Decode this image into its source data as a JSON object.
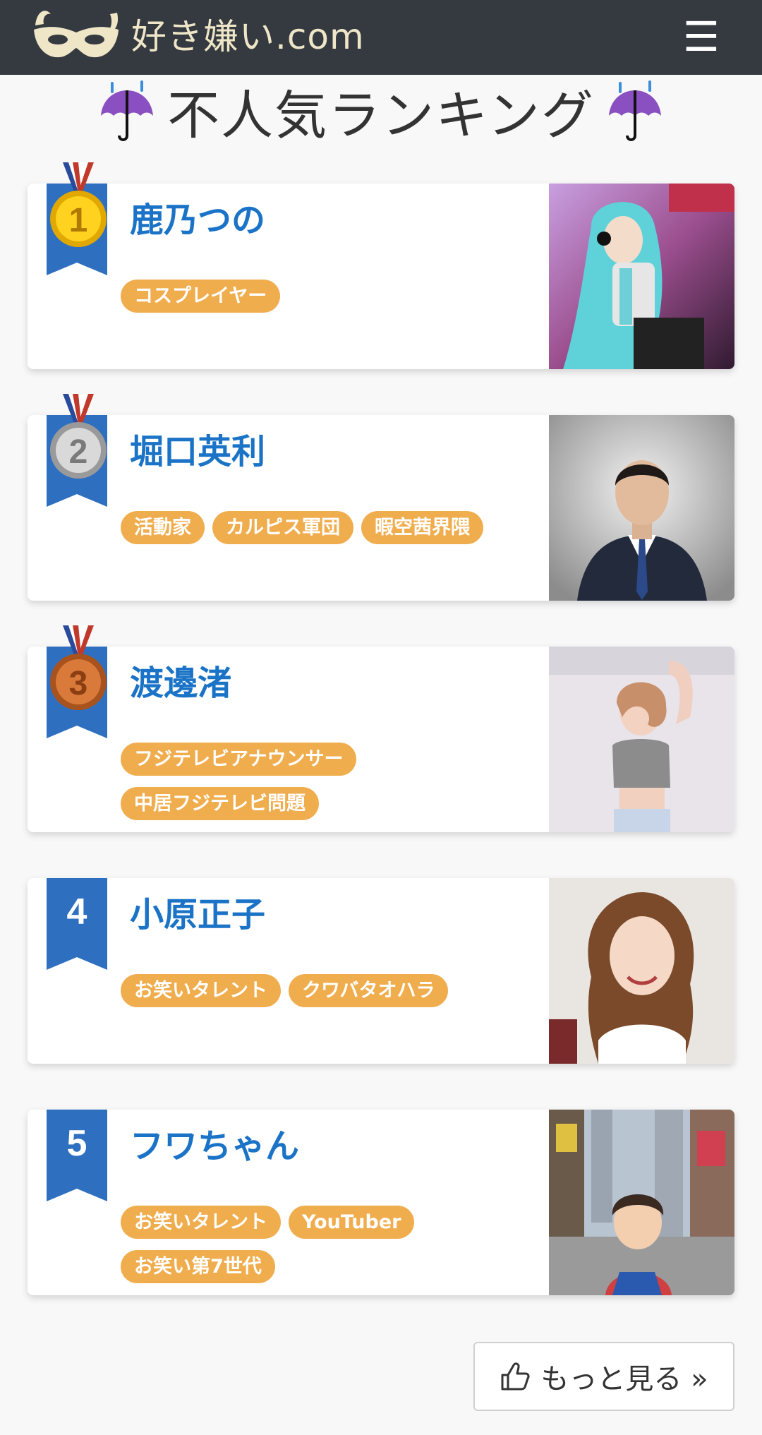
{
  "header": {
    "logo_text": "好き嫌い.com",
    "menu_icon": "hamburger-icon",
    "menu_glyph": "☰"
  },
  "title": {
    "text": "不人気ランキング",
    "left_icon": "umbrella-rain-icon",
    "right_icon": "umbrella-rain-icon"
  },
  "ranking": [
    {
      "rank": "1",
      "badge": "gold-medal-icon",
      "name": "鹿乃つの",
      "tags": [
        "コスプレイヤー"
      ],
      "photo": "person-photo"
    },
    {
      "rank": "2",
      "badge": "silver-medal-icon",
      "name": "堀口英利",
      "tags": [
        "活動家",
        "カルピス軍団",
        "暇空茜界隈"
      ],
      "photo": "person-photo"
    },
    {
      "rank": "3",
      "badge": "bronze-medal-icon",
      "name": "渡邊渚",
      "tags": [
        "フジテレビアナウンサー",
        "中居フジテレビ問題"
      ],
      "photo": "person-photo"
    },
    {
      "rank": "4",
      "badge": "ribbon",
      "name": "小原正子",
      "tags": [
        "お笑いタレント",
        "クワバタオハラ"
      ],
      "photo": "person-photo"
    },
    {
      "rank": "5",
      "badge": "ribbon",
      "name": "フワちゃん",
      "tags": [
        "お笑いタレント",
        "YouTuber",
        "お笑い第7世代"
      ],
      "photo": "person-photo"
    }
  ],
  "more_button": {
    "label": "もっと見る »",
    "icon": "thumbs-up-icon"
  },
  "colors": {
    "header_bg": "#343a40",
    "name": "#1a73c6",
    "tag_bg": "#f0ad4e",
    "ribbon": "#2e6fc0"
  }
}
